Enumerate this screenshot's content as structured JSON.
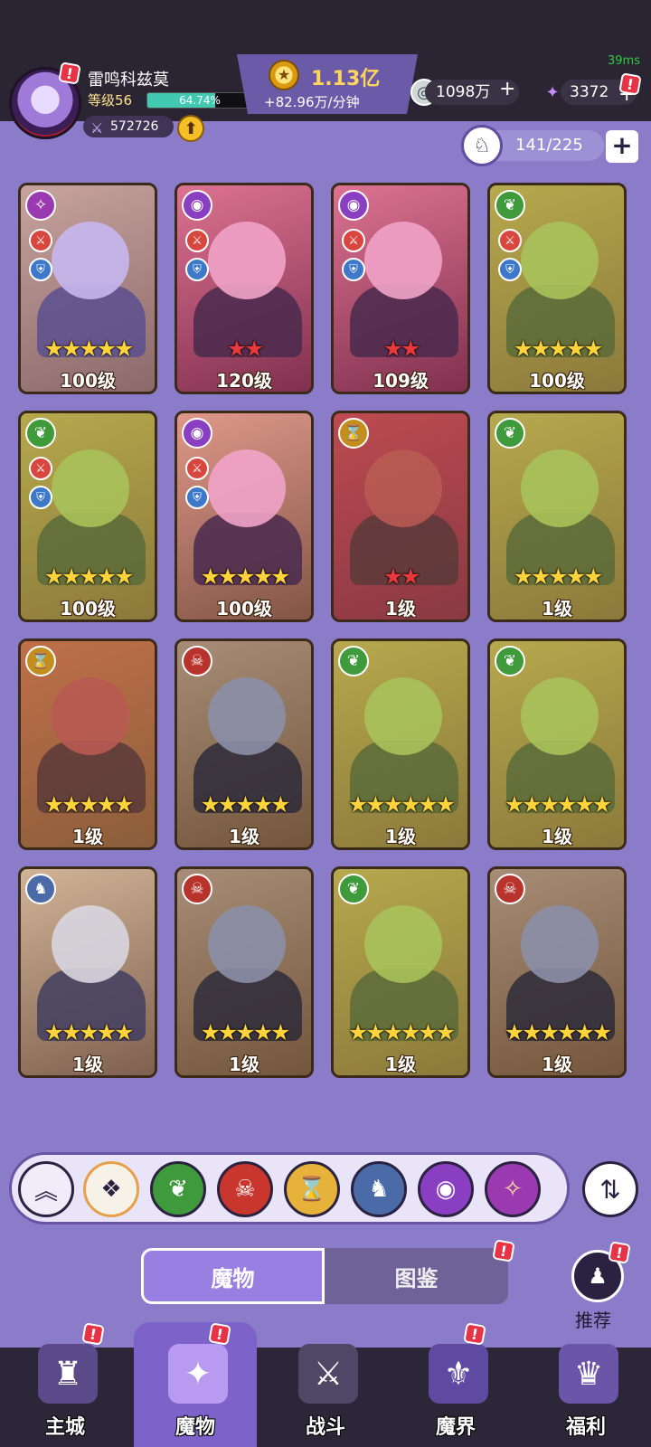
{
  "status": {
    "ping": "39ms"
  },
  "player": {
    "name": "雷鸣科兹莫",
    "level_label": "等级56",
    "exp_percent_text": "64.74%",
    "exp_fraction": 0.6474,
    "power": "572726"
  },
  "gold": {
    "amount": "1.13亿",
    "rate": "+82.96万/分钟"
  },
  "resources": {
    "silver": "1098万",
    "crystal": "3372"
  },
  "capacity": {
    "text": "141/225"
  },
  "cards": [
    {
      "faction": "chaos",
      "stars": 5,
      "star_color": "gold",
      "level": "100级",
      "frame": "gold",
      "badges": true
    },
    {
      "faction": "eye",
      "stars": 2,
      "star_color": "red",
      "level": "120级",
      "frame": "red",
      "badges": true
    },
    {
      "faction": "eye",
      "stars": 2,
      "star_color": "red",
      "level": "109级",
      "frame": "red",
      "badges": true
    },
    {
      "faction": "nature",
      "stars": 5,
      "star_color": "gold",
      "level": "100级",
      "frame": "gold",
      "badges": true
    },
    {
      "faction": "nature",
      "stars": 5,
      "star_color": "gold",
      "level": "100级",
      "frame": "gold",
      "badges": true
    },
    {
      "faction": "eye",
      "stars": 5,
      "star_color": "gold",
      "level": "100级",
      "frame": "gold",
      "badges": true
    },
    {
      "faction": "hourglass",
      "stars": 2,
      "star_color": "red",
      "level": "1级",
      "frame": "red",
      "badges": false
    },
    {
      "faction": "nature",
      "stars": 5,
      "star_color": "gold",
      "level": "1级",
      "frame": "gold",
      "badges": false
    },
    {
      "faction": "hourglass",
      "stars": 5,
      "star_color": "gold",
      "level": "1级",
      "frame": "gold",
      "badges": false
    },
    {
      "faction": "demon",
      "stars": 5,
      "star_color": "gold",
      "level": "1级",
      "frame": "gold",
      "badges": false
    },
    {
      "faction": "nature",
      "stars": 6,
      "star_color": "gold",
      "level": "1级",
      "frame": "gold",
      "badges": false
    },
    {
      "faction": "nature",
      "stars": 6,
      "star_color": "gold",
      "level": "1级",
      "frame": "gold",
      "badges": false
    },
    {
      "faction": "dragon",
      "stars": 5,
      "star_color": "gold",
      "level": "1级",
      "frame": "gold",
      "badges": false
    },
    {
      "faction": "demon",
      "stars": 5,
      "star_color": "gold",
      "level": "1级",
      "frame": "gold",
      "badges": false
    },
    {
      "faction": "nature",
      "stars": 6,
      "star_color": "gold",
      "level": "1级",
      "frame": "gold",
      "badges": false
    },
    {
      "faction": "demon",
      "stars": 6,
      "star_color": "gold",
      "level": "1级",
      "frame": "gold",
      "badges": false
    }
  ],
  "filters": [
    {
      "name": "collapse",
      "icon": "︽",
      "bg": "#f1ecfa",
      "fg": "#2a2240"
    },
    {
      "name": "all",
      "icon": "❖",
      "bg": "#f7f2e8",
      "fg": "#2a2240"
    },
    {
      "name": "nature",
      "icon": "❦",
      "bg": "#3f9a3c",
      "fg": "#fff"
    },
    {
      "name": "demon",
      "icon": "☠",
      "bg": "#c8362e",
      "fg": "#fff"
    },
    {
      "name": "hourglass",
      "icon": "⌛",
      "bg": "#e7b23a",
      "fg": "#4b2a00"
    },
    {
      "name": "dragon",
      "icon": "♞",
      "bg": "#4a6aa8",
      "fg": "#fff"
    },
    {
      "name": "eye",
      "icon": "◉",
      "bg": "#8a3fc2",
      "fg": "#fff"
    },
    {
      "name": "chaos",
      "icon": "✧",
      "bg": "#9b3ab0",
      "fg": "#ffe29a"
    }
  ],
  "tabs": {
    "monsters": "魔物",
    "codex": "图鉴"
  },
  "recommend_label": "推荐",
  "nav": [
    {
      "label": "主城",
      "icon": "♜"
    },
    {
      "label": "魔物",
      "icon": "✦"
    },
    {
      "label": "战斗",
      "icon": "⚔"
    },
    {
      "label": "魔界",
      "icon": "⚜"
    },
    {
      "label": "福利",
      "icon": "♛"
    }
  ],
  "colors": {
    "accent": "#7d62c9",
    "gold_text": "#ffd65a",
    "alert_red": "#e63346"
  }
}
